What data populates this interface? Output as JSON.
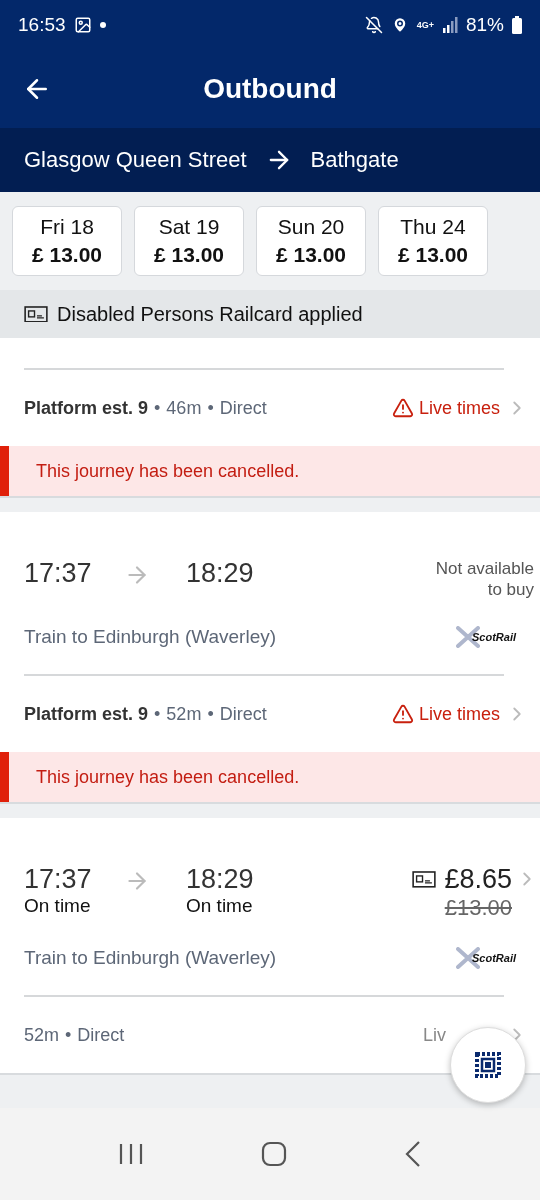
{
  "status_bar": {
    "time": "16:53",
    "network": "4G+",
    "battery": "81%"
  },
  "header": {
    "title": "Outbound"
  },
  "route": {
    "from": "Glasgow Queen Street",
    "to": "Bathgate"
  },
  "dates": [
    {
      "day": "Fri 18",
      "price": "£ 13.00"
    },
    {
      "day": "Sat 19",
      "price": "£ 13.00"
    },
    {
      "day": "Sun 20",
      "price": "£ 13.00"
    },
    {
      "day": "Thu 24",
      "price": "£ 13.00"
    }
  ],
  "railcard_banner": "Disabled Persons Railcard applied",
  "journeys": [
    {
      "platform": "Platform est. 9",
      "separator": "•",
      "duration": "46m",
      "changes": "Direct",
      "live_times": {
        "label": "Live times",
        "warning": true
      },
      "cancelled_message": "This journey has been cancelled."
    },
    {
      "depart": "17:37",
      "arrive": "18:29",
      "price_note": "Not available to buy",
      "train": "Train to Edinburgh (Waverley)",
      "operator": "ScotRail",
      "platform": "Platform est. 9",
      "separator": "•",
      "duration": "52m",
      "changes": "Direct",
      "live_times": {
        "label": "Live times",
        "warning": true
      },
      "cancelled_message": "This journey has been cancelled."
    },
    {
      "depart": "17:37",
      "depart_status": "On time",
      "arrive": "18:29",
      "arrive_status": "On time",
      "railcard_applied": true,
      "price": "£8.65",
      "original_price": "£13.00",
      "train": "Train to Edinburgh (Waverley)",
      "operator": "ScotRail",
      "separator": "•",
      "duration": "52m",
      "changes": "Direct",
      "live_times": {
        "label": "Liv",
        "warning": false
      }
    }
  ]
}
